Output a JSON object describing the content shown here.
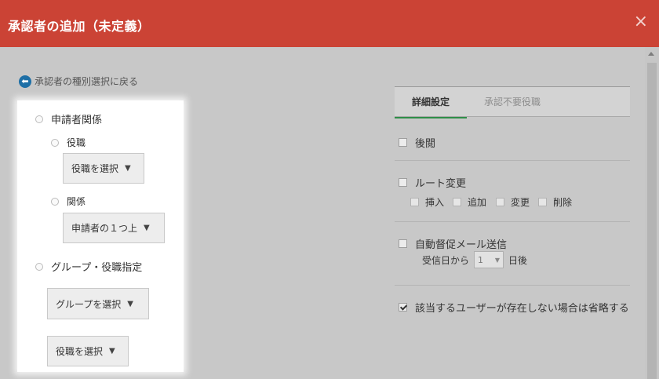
{
  "dialog": {
    "title": "承認者の追加（未定義）",
    "close_glyph": "×"
  },
  "back_link": {
    "icon": "arrow-left-circle-icon",
    "arrow_glyph": "⬅",
    "label": "承認者の種別選択に戻る"
  },
  "left": {
    "applicant_relation": {
      "label": "申請者関係"
    },
    "position": {
      "label": "役職",
      "button": "役職を選択"
    },
    "relation": {
      "label": "関係",
      "button": "申請者の１つ上"
    },
    "group_position": {
      "label": "グループ・役職指定",
      "group_button": "グループを選択",
      "position_button": "役職を選択"
    },
    "dropdown_glyph": "▼"
  },
  "tabs": [
    {
      "label": "詳細設定",
      "active": true
    },
    {
      "label": "承認不要役職",
      "active": false
    }
  ],
  "settings": {
    "review": {
      "label": "後閲",
      "checked": false
    },
    "route_change": {
      "label": "ルート変更",
      "checked": false,
      "options": [
        {
          "label": "挿入"
        },
        {
          "label": "追加"
        },
        {
          "label": "変更"
        },
        {
          "label": "削除"
        }
      ]
    },
    "auto_reminder": {
      "label": "自動督促メール送信",
      "checked": false,
      "prefix": "受信日から",
      "value": "1",
      "suffix": "日後"
    },
    "skip_missing": {
      "label": "該当するユーザーが存在しない場合は省略する",
      "checked": true
    }
  },
  "colors": {
    "header": "#cb4335",
    "overlay": "#c8c8c8",
    "tab_accent": "#2e8e48",
    "back_icon": "#1e6fa6"
  }
}
